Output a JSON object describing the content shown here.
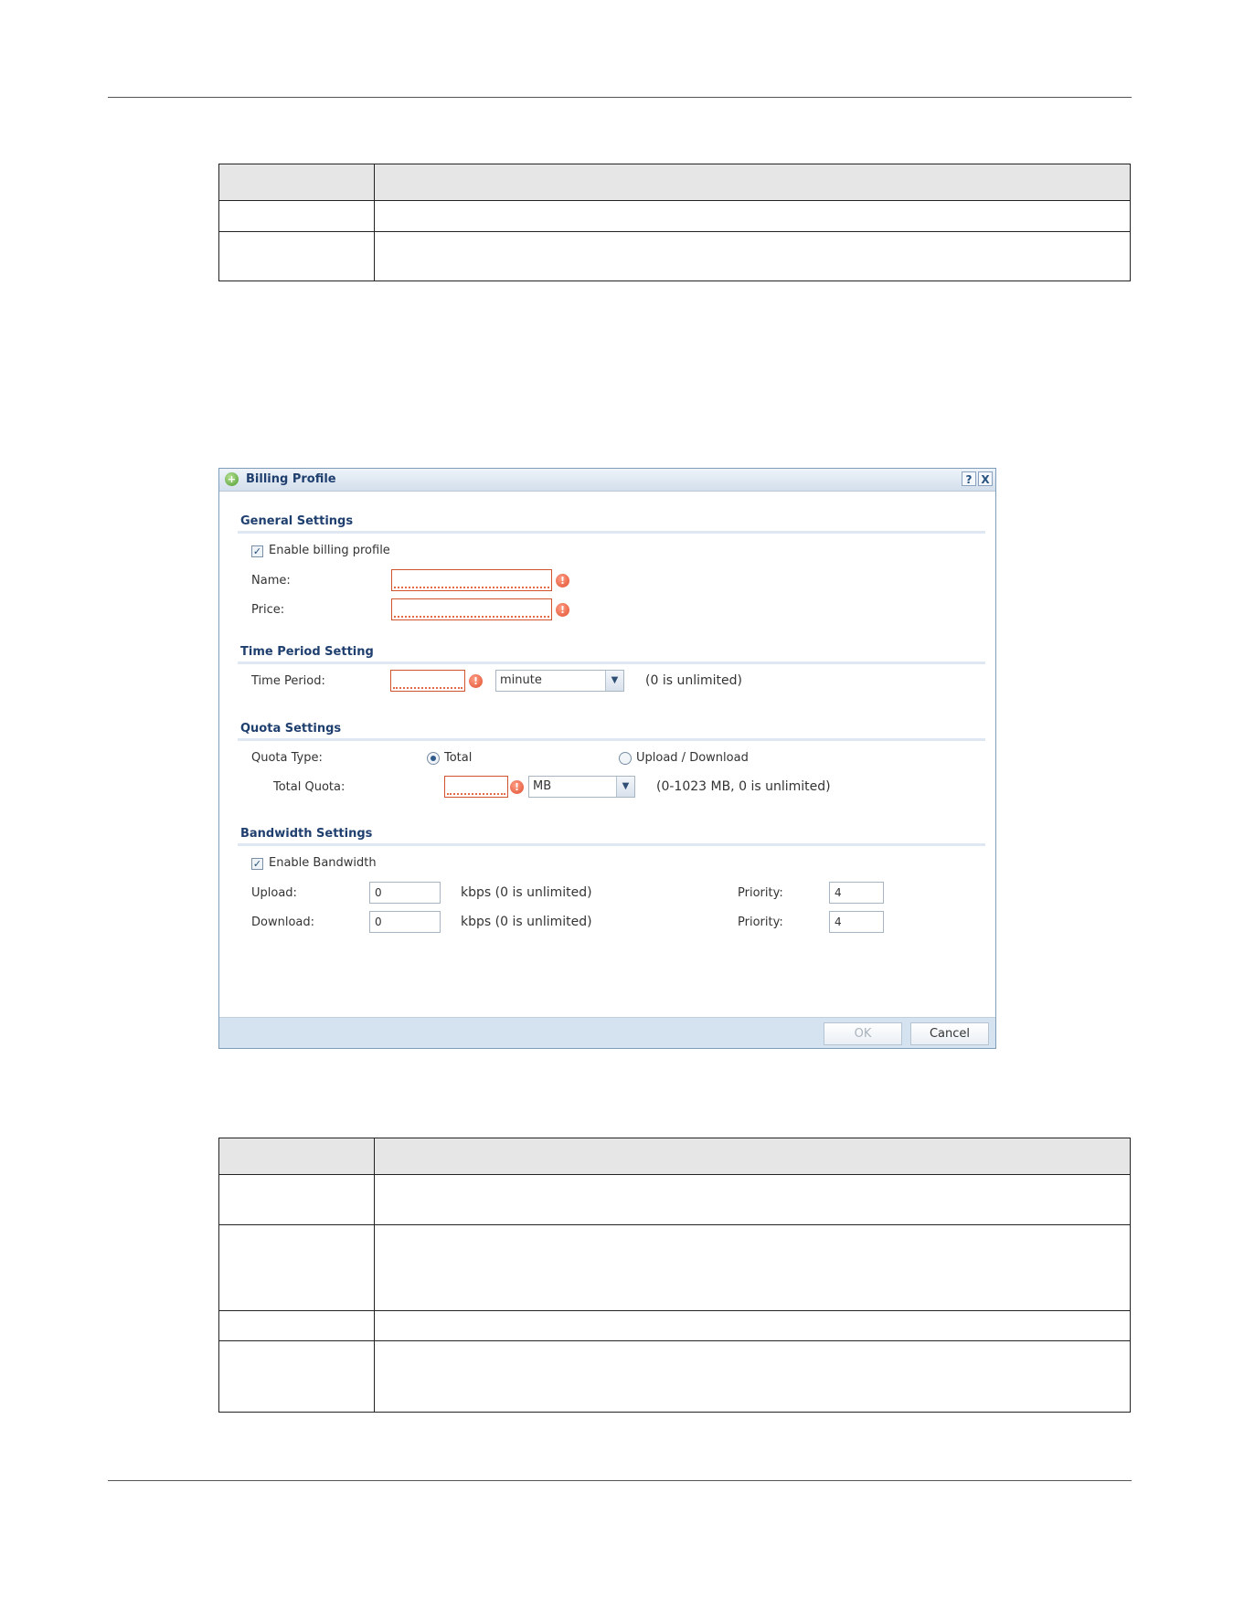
{
  "doc_table_top": {
    "rows": [
      "",
      "",
      ""
    ]
  },
  "dialog": {
    "title": "Billing Profile",
    "help_icon": "?",
    "close_icon": "X",
    "general": {
      "heading": "General Settings",
      "enable_label": "Enable billing profile",
      "enable_checked": true,
      "name_label": "Name:",
      "name_value": "",
      "price_label": "Price:",
      "price_value": ""
    },
    "time_period": {
      "heading": "Time Period Setting",
      "label": "Time Period:",
      "value": "",
      "unit": "minute",
      "hint": "(0 is unlimited)"
    },
    "quota": {
      "heading": "Quota Settings",
      "type_label": "Quota Type:",
      "option_total": "Total",
      "option_updown": "Upload / Download",
      "selected": "Total",
      "total_label": "Total Quota:",
      "total_value": "",
      "unit": "MB",
      "hint": "(0-1023 MB, 0 is unlimited)"
    },
    "bandwidth": {
      "heading": "Bandwidth Settings",
      "enable_label": "Enable Bandwidth",
      "enable_checked": true,
      "upload_label": "Upload:",
      "upload_value": "0",
      "upload_hint": "kbps (0 is unlimited)",
      "upload_priority_label": "Priority:",
      "upload_priority_value": "4",
      "download_label": "Download:",
      "download_value": "0",
      "download_hint": "kbps (0 is unlimited)",
      "download_priority_label": "Priority:",
      "download_priority_value": "4"
    },
    "buttons": {
      "ok": "OK",
      "cancel": "Cancel"
    }
  },
  "doc_table_bottom": {
    "rows": [
      "",
      "",
      "",
      "",
      ""
    ]
  }
}
